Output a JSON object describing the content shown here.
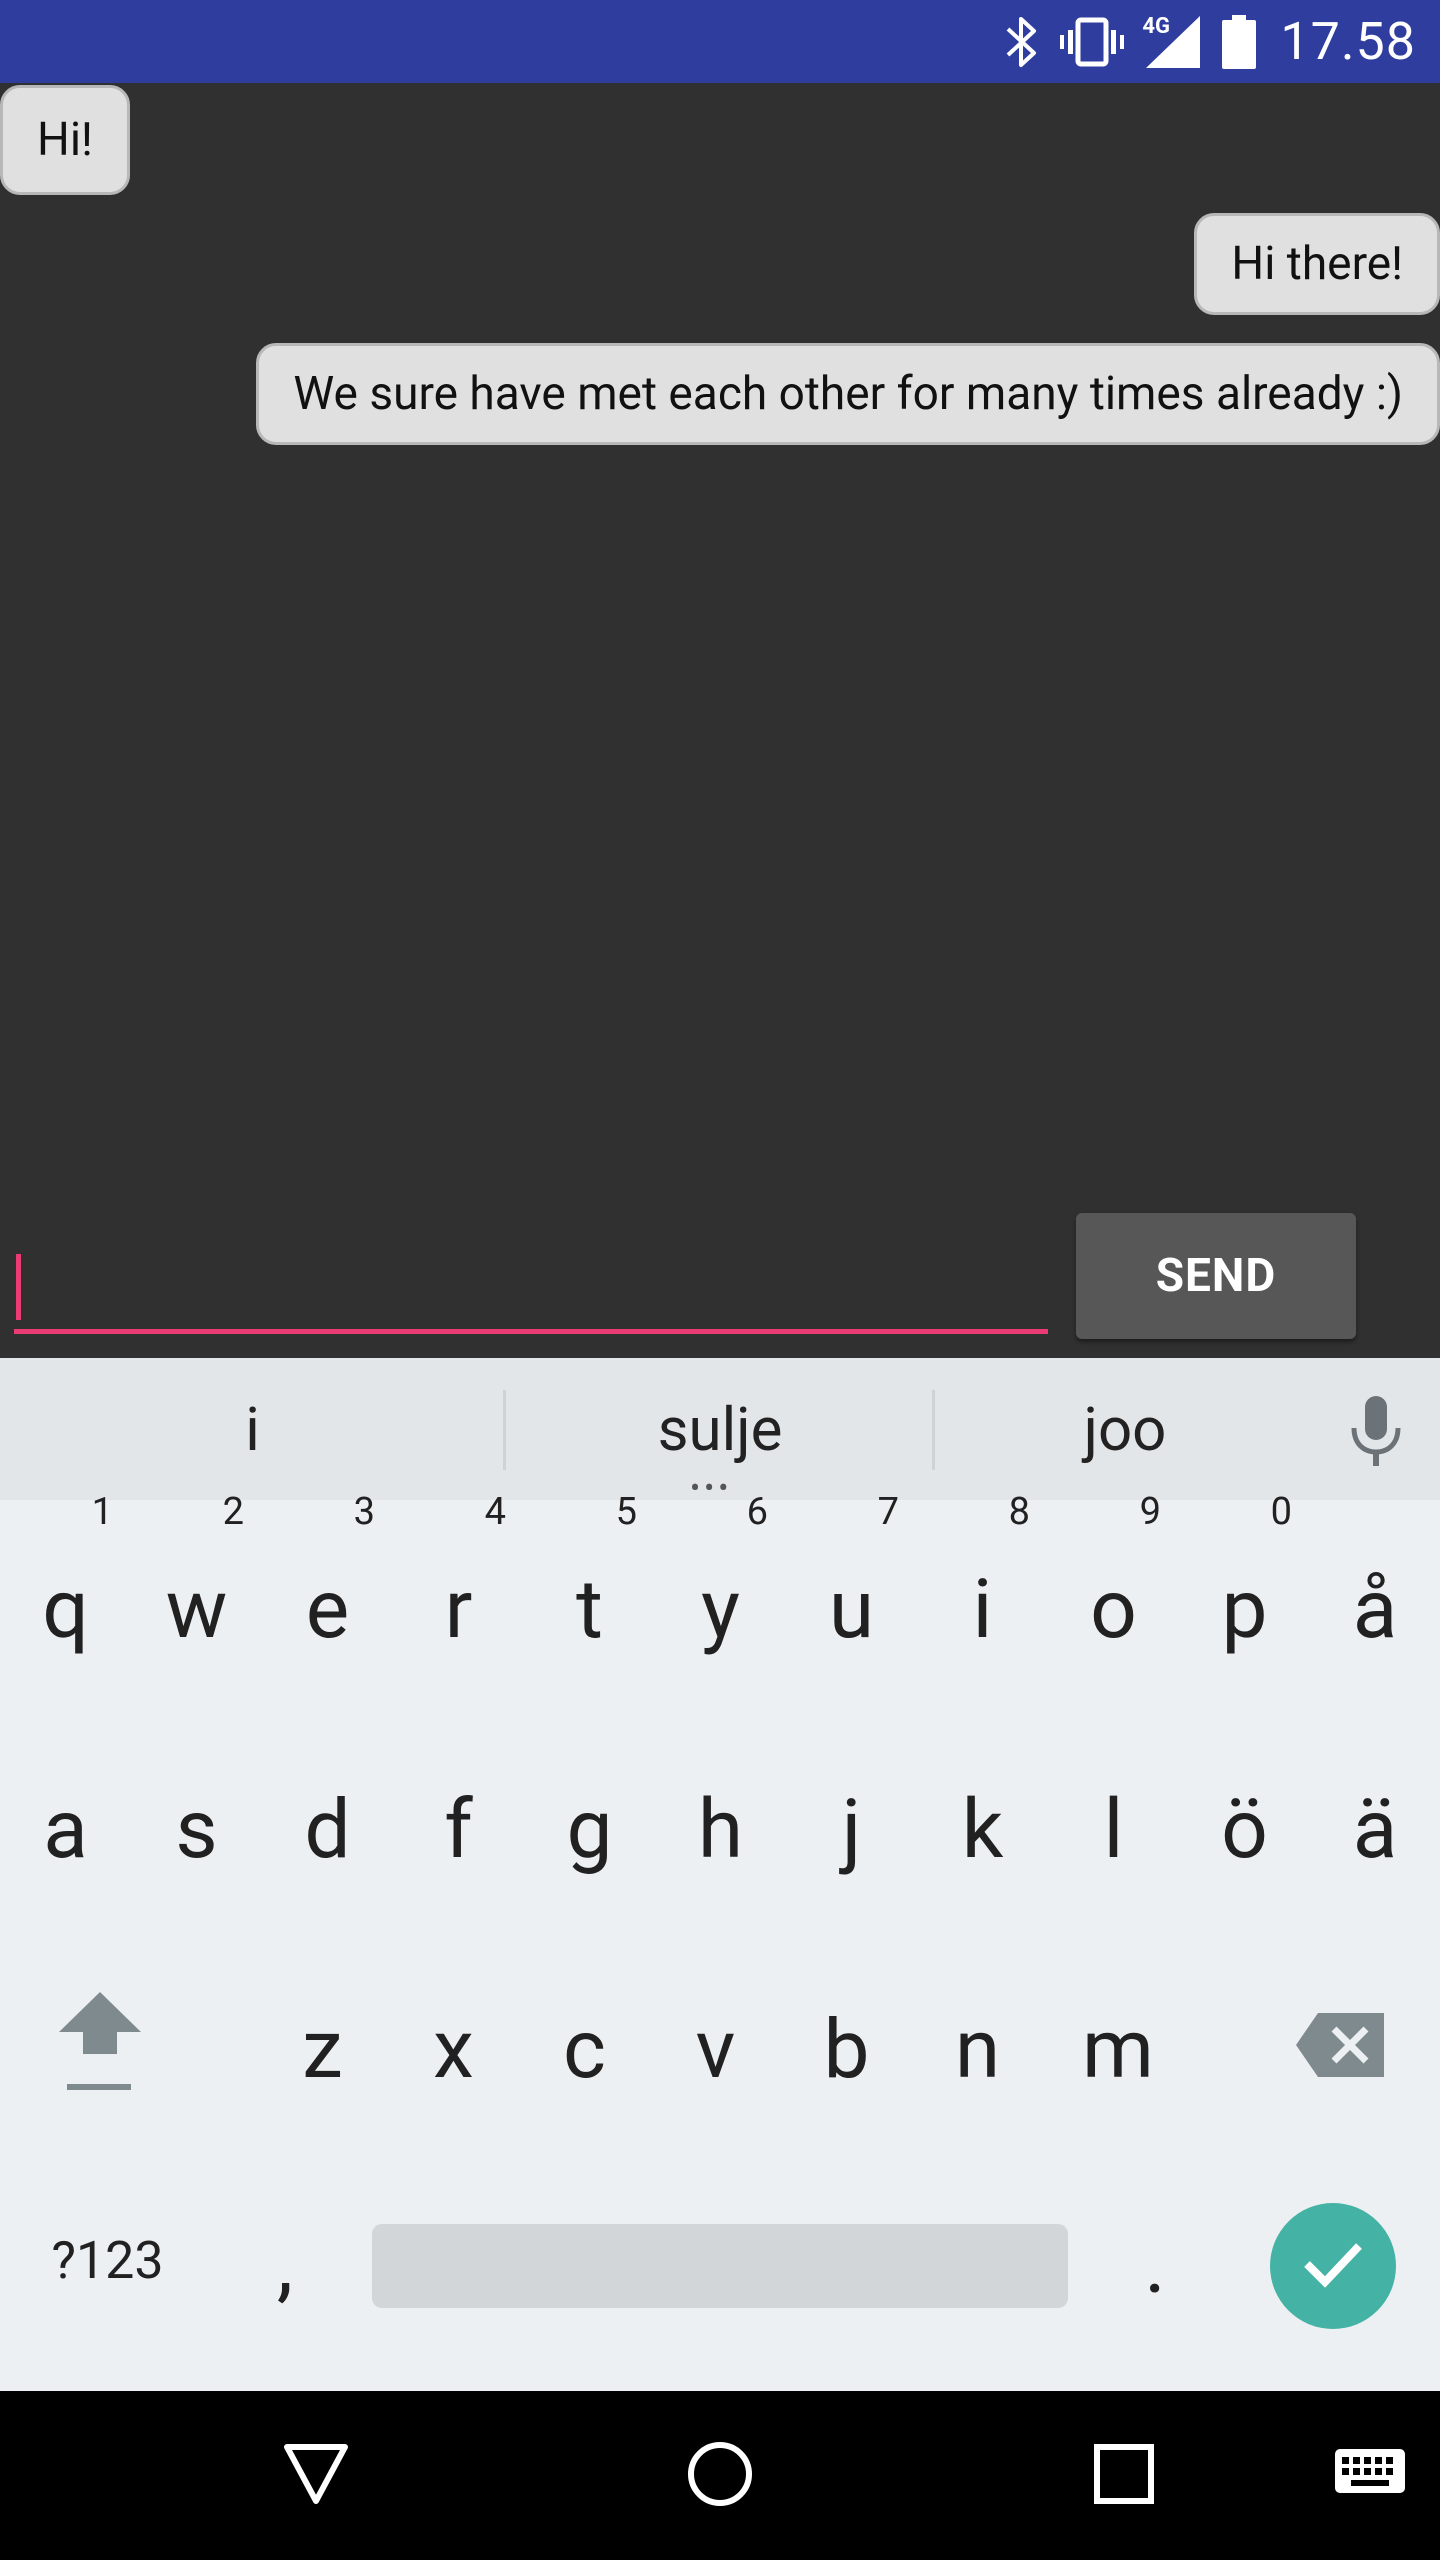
{
  "status_bar": {
    "time": "17.58",
    "network_label": "4G",
    "icons": [
      "bluetooth-icon",
      "vibrate-icon",
      "signal-icon",
      "battery-icon"
    ]
  },
  "chat": {
    "messages": [
      {
        "text": "Hi!",
        "side": "left"
      },
      {
        "text": "Hi there!",
        "side": "right"
      },
      {
        "text": "We sure have met each other for many times already :)",
        "side": "right"
      }
    ]
  },
  "composer": {
    "input_value": "",
    "send_label": "SEND"
  },
  "keyboard": {
    "suggestions": [
      "i",
      "sulje",
      "joo"
    ],
    "row1": [
      {
        "key": "q",
        "hint": "1"
      },
      {
        "key": "w",
        "hint": "2"
      },
      {
        "key": "e",
        "hint": "3"
      },
      {
        "key": "r",
        "hint": "4"
      },
      {
        "key": "t",
        "hint": "5"
      },
      {
        "key": "y",
        "hint": "6"
      },
      {
        "key": "u",
        "hint": "7"
      },
      {
        "key": "i",
        "hint": "8"
      },
      {
        "key": "o",
        "hint": "9"
      },
      {
        "key": "p",
        "hint": "0"
      },
      {
        "key": "å",
        "hint": ""
      }
    ],
    "row2": [
      "a",
      "s",
      "d",
      "f",
      "g",
      "h",
      "j",
      "k",
      "l",
      "ö",
      "ä"
    ],
    "row3": [
      "z",
      "x",
      "c",
      "v",
      "b",
      "n",
      "m"
    ],
    "symbols_label": "?123",
    "comma_label": ",",
    "period_label": ".",
    "accent_color": "#44b3a5"
  },
  "colors": {
    "status_bar": "#2f3e9e",
    "chat_background": "#303030",
    "bubble": "#e0e0e0",
    "input_underline": "#ea3b74",
    "send_button": "#575757"
  }
}
